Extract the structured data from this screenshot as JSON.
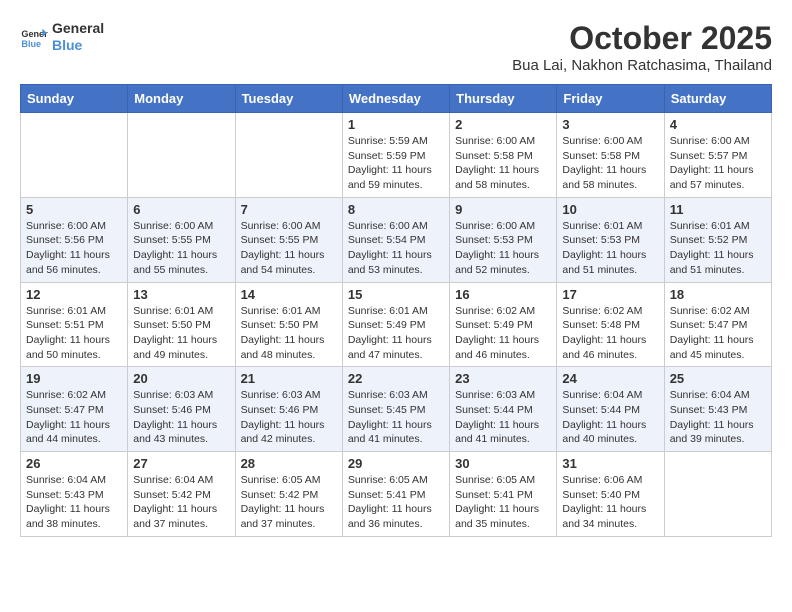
{
  "header": {
    "logo_line1": "General",
    "logo_line2": "Blue",
    "month": "October 2025",
    "location": "Bua Lai, Nakhon Ratchasima, Thailand"
  },
  "weekdays": [
    "Sunday",
    "Monday",
    "Tuesday",
    "Wednesday",
    "Thursday",
    "Friday",
    "Saturday"
  ],
  "weeks": [
    [
      {
        "day": "",
        "info": ""
      },
      {
        "day": "",
        "info": ""
      },
      {
        "day": "",
        "info": ""
      },
      {
        "day": "1",
        "info": "Sunrise: 5:59 AM\nSunset: 5:59 PM\nDaylight: 11 hours and 59 minutes."
      },
      {
        "day": "2",
        "info": "Sunrise: 6:00 AM\nSunset: 5:58 PM\nDaylight: 11 hours and 58 minutes."
      },
      {
        "day": "3",
        "info": "Sunrise: 6:00 AM\nSunset: 5:58 PM\nDaylight: 11 hours and 58 minutes."
      },
      {
        "day": "4",
        "info": "Sunrise: 6:00 AM\nSunset: 5:57 PM\nDaylight: 11 hours and 57 minutes."
      }
    ],
    [
      {
        "day": "5",
        "info": "Sunrise: 6:00 AM\nSunset: 5:56 PM\nDaylight: 11 hours and 56 minutes."
      },
      {
        "day": "6",
        "info": "Sunrise: 6:00 AM\nSunset: 5:55 PM\nDaylight: 11 hours and 55 minutes."
      },
      {
        "day": "7",
        "info": "Sunrise: 6:00 AM\nSunset: 5:55 PM\nDaylight: 11 hours and 54 minutes."
      },
      {
        "day": "8",
        "info": "Sunrise: 6:00 AM\nSunset: 5:54 PM\nDaylight: 11 hours and 53 minutes."
      },
      {
        "day": "9",
        "info": "Sunrise: 6:00 AM\nSunset: 5:53 PM\nDaylight: 11 hours and 52 minutes."
      },
      {
        "day": "10",
        "info": "Sunrise: 6:01 AM\nSunset: 5:53 PM\nDaylight: 11 hours and 51 minutes."
      },
      {
        "day": "11",
        "info": "Sunrise: 6:01 AM\nSunset: 5:52 PM\nDaylight: 11 hours and 51 minutes."
      }
    ],
    [
      {
        "day": "12",
        "info": "Sunrise: 6:01 AM\nSunset: 5:51 PM\nDaylight: 11 hours and 50 minutes."
      },
      {
        "day": "13",
        "info": "Sunrise: 6:01 AM\nSunset: 5:50 PM\nDaylight: 11 hours and 49 minutes."
      },
      {
        "day": "14",
        "info": "Sunrise: 6:01 AM\nSunset: 5:50 PM\nDaylight: 11 hours and 48 minutes."
      },
      {
        "day": "15",
        "info": "Sunrise: 6:01 AM\nSunset: 5:49 PM\nDaylight: 11 hours and 47 minutes."
      },
      {
        "day": "16",
        "info": "Sunrise: 6:02 AM\nSunset: 5:49 PM\nDaylight: 11 hours and 46 minutes."
      },
      {
        "day": "17",
        "info": "Sunrise: 6:02 AM\nSunset: 5:48 PM\nDaylight: 11 hours and 46 minutes."
      },
      {
        "day": "18",
        "info": "Sunrise: 6:02 AM\nSunset: 5:47 PM\nDaylight: 11 hours and 45 minutes."
      }
    ],
    [
      {
        "day": "19",
        "info": "Sunrise: 6:02 AM\nSunset: 5:47 PM\nDaylight: 11 hours and 44 minutes."
      },
      {
        "day": "20",
        "info": "Sunrise: 6:03 AM\nSunset: 5:46 PM\nDaylight: 11 hours and 43 minutes."
      },
      {
        "day": "21",
        "info": "Sunrise: 6:03 AM\nSunset: 5:46 PM\nDaylight: 11 hours and 42 minutes."
      },
      {
        "day": "22",
        "info": "Sunrise: 6:03 AM\nSunset: 5:45 PM\nDaylight: 11 hours and 41 minutes."
      },
      {
        "day": "23",
        "info": "Sunrise: 6:03 AM\nSunset: 5:44 PM\nDaylight: 11 hours and 41 minutes."
      },
      {
        "day": "24",
        "info": "Sunrise: 6:04 AM\nSunset: 5:44 PM\nDaylight: 11 hours and 40 minutes."
      },
      {
        "day": "25",
        "info": "Sunrise: 6:04 AM\nSunset: 5:43 PM\nDaylight: 11 hours and 39 minutes."
      }
    ],
    [
      {
        "day": "26",
        "info": "Sunrise: 6:04 AM\nSunset: 5:43 PM\nDaylight: 11 hours and 38 minutes."
      },
      {
        "day": "27",
        "info": "Sunrise: 6:04 AM\nSunset: 5:42 PM\nDaylight: 11 hours and 37 minutes."
      },
      {
        "day": "28",
        "info": "Sunrise: 6:05 AM\nSunset: 5:42 PM\nDaylight: 11 hours and 37 minutes."
      },
      {
        "day": "29",
        "info": "Sunrise: 6:05 AM\nSunset: 5:41 PM\nDaylight: 11 hours and 36 minutes."
      },
      {
        "day": "30",
        "info": "Sunrise: 6:05 AM\nSunset: 5:41 PM\nDaylight: 11 hours and 35 minutes."
      },
      {
        "day": "31",
        "info": "Sunrise: 6:06 AM\nSunset: 5:40 PM\nDaylight: 11 hours and 34 minutes."
      },
      {
        "day": "",
        "info": ""
      }
    ]
  ]
}
